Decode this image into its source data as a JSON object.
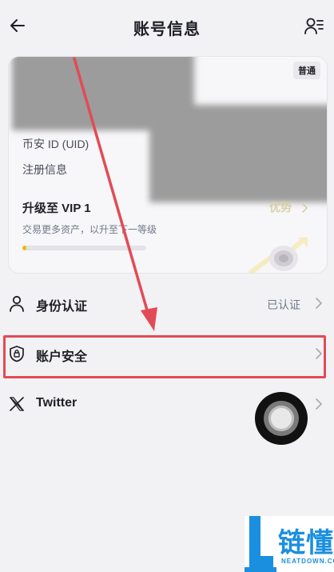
{
  "header": {
    "title": "账号信息",
    "back_icon": "arrow-left-icon",
    "profile_icon": "user-list-icon"
  },
  "card": {
    "tier_badge": "普通",
    "uid_label": "币安 ID (UID)",
    "registration_label": "注册信息",
    "upgrade_title": "升级至 VIP 1",
    "upgrade_subtitle": "交易更多资产，以升至下一等级",
    "advantage_label": "优势",
    "progress_fraction": 0.03,
    "accent_color": "#f0b90b"
  },
  "rows": {
    "identity": {
      "label": "身份认证",
      "value": "已认证",
      "icon": "user-icon"
    },
    "security": {
      "label": "账户安全",
      "icon": "shield-lock-icon"
    },
    "twitter": {
      "label": "Twitter",
      "icon": "x-logo-icon"
    }
  },
  "annotation": {
    "highlight_color": "#e24b55"
  },
  "watermark": {
    "title": "链懂",
    "subtitle": "NEATDOWN.COM"
  }
}
